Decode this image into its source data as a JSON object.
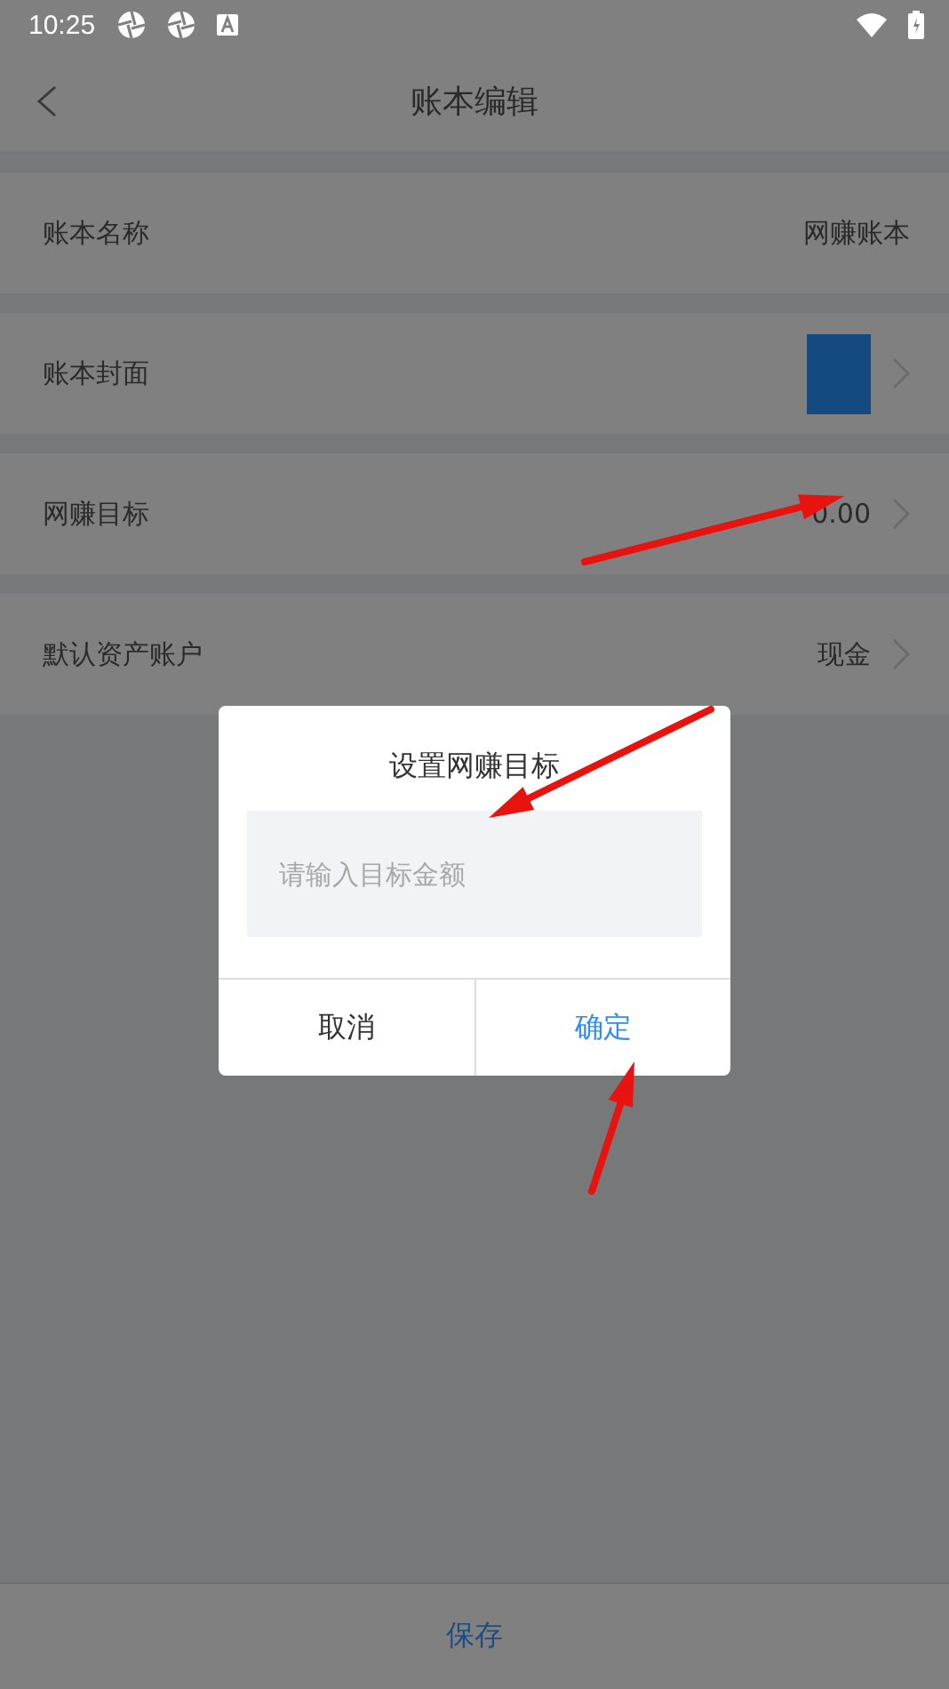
{
  "status_bar": {
    "time": "10:25"
  },
  "header": {
    "title": "账本编辑"
  },
  "rows": [
    {
      "kind": "text",
      "label": "账本名称",
      "value": "网赚账本"
    },
    {
      "kind": "cover",
      "label": "账本封面"
    },
    {
      "kind": "link",
      "label": "网赚目标",
      "value": "0.00"
    },
    {
      "kind": "link",
      "label": "默认资产账户",
      "value": "现金"
    }
  ],
  "dialog": {
    "title": "设置网赚目标",
    "placeholder": "请输入目标金额",
    "buttons": [
      {
        "label": "取消",
        "kind": "cancel"
      },
      {
        "label": "确定",
        "kind": "confirm"
      }
    ]
  },
  "footer": {
    "save": "保存"
  }
}
